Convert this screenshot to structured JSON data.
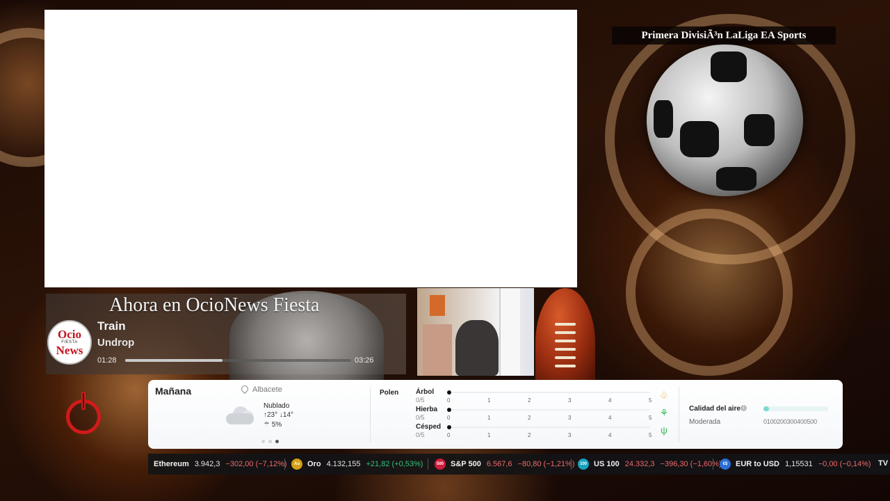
{
  "league_banner": "Primera DivisiÃ³n LaLiga EA Sports",
  "now_playing": {
    "title": "Ahora en OcioNews Fiesta",
    "logo_line1": "Ocio",
    "logo_line2": "FIESTA",
    "logo_line3": "News",
    "track": "Train",
    "artist": "Undrop",
    "time_current": "01:28",
    "time_total": "03:26",
    "progress": 0.43
  },
  "weather": {
    "day": "Mañana",
    "location": "Albacete",
    "condition": "Nublado",
    "temp_high": "↑23°",
    "temp_low": "↓14°",
    "rain_icon": "☂",
    "rain_chance": "5%",
    "pages": 3,
    "active_page": 3
  },
  "pollen": {
    "title": "Polen",
    "ticks": [
      "0",
      "1",
      "2",
      "3",
      "4",
      "5"
    ],
    "rows": [
      {
        "name": "Árbol",
        "value": "0/5",
        "level": 0,
        "icon": "tree-icon",
        "glyph": "♧",
        "color": "#e5a825"
      },
      {
        "name": "Hierba",
        "value": "0/5",
        "level": 0,
        "icon": "weed-icon",
        "glyph": "⚘",
        "color": "#3dbb5a"
      },
      {
        "name": "Césped",
        "value": "0/5",
        "level": 0,
        "icon": "grass-icon",
        "glyph": "ψ",
        "color": "#3dbb5a"
      }
    ]
  },
  "air_quality": {
    "title": "Calidad del aire",
    "info_glyph": "i",
    "level": "Moderada",
    "scale": "0100200300400500",
    "color": "#7ddad0"
  },
  "ticker": [
    {
      "badge": "",
      "badge_color": "",
      "name": "Ethereum",
      "price": "3.942,3",
      "change": "−302,00 (−7,12%)",
      "price_neg": false,
      "dir": "neg"
    },
    {
      "badge": "Au",
      "badge_color": "#d4a017",
      "name": "Oro",
      "price": "4.132,155",
      "change": "+21,82 (+0,53%)",
      "price_neg": false,
      "dir": "pos"
    },
    {
      "badge": "500",
      "badge_color": "#d01c3c",
      "name": "S&P 500",
      "price": "6.567,6",
      "change": "−80,80 (−1,21%)",
      "price_neg": true,
      "dir": "neg"
    },
    {
      "badge": "100",
      "badge_color": "#17a2c0",
      "name": "US 100",
      "price": "24.332,3",
      "change": "−396,30 (−1,60%)",
      "price_neg": true,
      "dir": "neg"
    },
    {
      "badge": "€$",
      "badge_color": "#2a6fd8",
      "name": "EUR to USD",
      "price": "1,15531",
      "change": "−0,00 (−0,14%)",
      "price_neg": false,
      "dir": "neg"
    }
  ],
  "ticker_brand": "TV"
}
